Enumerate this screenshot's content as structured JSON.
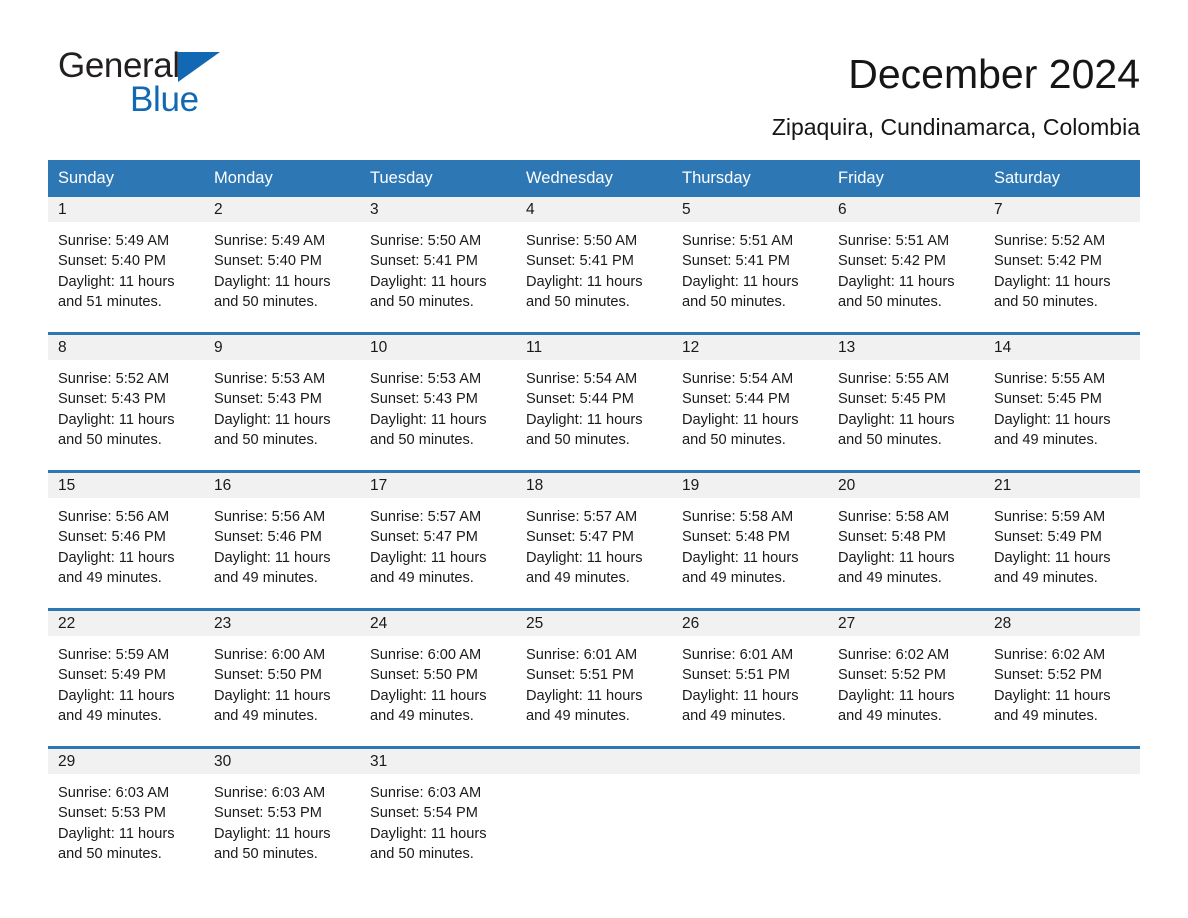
{
  "brand": {
    "name_part1": "General",
    "name_part2": "Blue",
    "accent_color": "#1268b3"
  },
  "header": {
    "title": "December 2024",
    "location": "Zipaquira, Cundinamarca, Colombia"
  },
  "calendar": {
    "header_color": "#2e77b5",
    "weekdays": [
      "Sunday",
      "Monday",
      "Tuesday",
      "Wednesday",
      "Thursday",
      "Friday",
      "Saturday"
    ],
    "weeks": [
      [
        {
          "day": "1",
          "sunrise": "Sunrise: 5:49 AM",
          "sunset": "Sunset: 5:40 PM",
          "daylight": "Daylight: 11 hours and 51 minutes."
        },
        {
          "day": "2",
          "sunrise": "Sunrise: 5:49 AM",
          "sunset": "Sunset: 5:40 PM",
          "daylight": "Daylight: 11 hours and 50 minutes."
        },
        {
          "day": "3",
          "sunrise": "Sunrise: 5:50 AM",
          "sunset": "Sunset: 5:41 PM",
          "daylight": "Daylight: 11 hours and 50 minutes."
        },
        {
          "day": "4",
          "sunrise": "Sunrise: 5:50 AM",
          "sunset": "Sunset: 5:41 PM",
          "daylight": "Daylight: 11 hours and 50 minutes."
        },
        {
          "day": "5",
          "sunrise": "Sunrise: 5:51 AM",
          "sunset": "Sunset: 5:41 PM",
          "daylight": "Daylight: 11 hours and 50 minutes."
        },
        {
          "day": "6",
          "sunrise": "Sunrise: 5:51 AM",
          "sunset": "Sunset: 5:42 PM",
          "daylight": "Daylight: 11 hours and 50 minutes."
        },
        {
          "day": "7",
          "sunrise": "Sunrise: 5:52 AM",
          "sunset": "Sunset: 5:42 PM",
          "daylight": "Daylight: 11 hours and 50 minutes."
        }
      ],
      [
        {
          "day": "8",
          "sunrise": "Sunrise: 5:52 AM",
          "sunset": "Sunset: 5:43 PM",
          "daylight": "Daylight: 11 hours and 50 minutes."
        },
        {
          "day": "9",
          "sunrise": "Sunrise: 5:53 AM",
          "sunset": "Sunset: 5:43 PM",
          "daylight": "Daylight: 11 hours and 50 minutes."
        },
        {
          "day": "10",
          "sunrise": "Sunrise: 5:53 AM",
          "sunset": "Sunset: 5:43 PM",
          "daylight": "Daylight: 11 hours and 50 minutes."
        },
        {
          "day": "11",
          "sunrise": "Sunrise: 5:54 AM",
          "sunset": "Sunset: 5:44 PM",
          "daylight": "Daylight: 11 hours and 50 minutes."
        },
        {
          "day": "12",
          "sunrise": "Sunrise: 5:54 AM",
          "sunset": "Sunset: 5:44 PM",
          "daylight": "Daylight: 11 hours and 50 minutes."
        },
        {
          "day": "13",
          "sunrise": "Sunrise: 5:55 AM",
          "sunset": "Sunset: 5:45 PM",
          "daylight": "Daylight: 11 hours and 50 minutes."
        },
        {
          "day": "14",
          "sunrise": "Sunrise: 5:55 AM",
          "sunset": "Sunset: 5:45 PM",
          "daylight": "Daylight: 11 hours and 49 minutes."
        }
      ],
      [
        {
          "day": "15",
          "sunrise": "Sunrise: 5:56 AM",
          "sunset": "Sunset: 5:46 PM",
          "daylight": "Daylight: 11 hours and 49 minutes."
        },
        {
          "day": "16",
          "sunrise": "Sunrise: 5:56 AM",
          "sunset": "Sunset: 5:46 PM",
          "daylight": "Daylight: 11 hours and 49 minutes."
        },
        {
          "day": "17",
          "sunrise": "Sunrise: 5:57 AM",
          "sunset": "Sunset: 5:47 PM",
          "daylight": "Daylight: 11 hours and 49 minutes."
        },
        {
          "day": "18",
          "sunrise": "Sunrise: 5:57 AM",
          "sunset": "Sunset: 5:47 PM",
          "daylight": "Daylight: 11 hours and 49 minutes."
        },
        {
          "day": "19",
          "sunrise": "Sunrise: 5:58 AM",
          "sunset": "Sunset: 5:48 PM",
          "daylight": "Daylight: 11 hours and 49 minutes."
        },
        {
          "day": "20",
          "sunrise": "Sunrise: 5:58 AM",
          "sunset": "Sunset: 5:48 PM",
          "daylight": "Daylight: 11 hours and 49 minutes."
        },
        {
          "day": "21",
          "sunrise": "Sunrise: 5:59 AM",
          "sunset": "Sunset: 5:49 PM",
          "daylight": "Daylight: 11 hours and 49 minutes."
        }
      ],
      [
        {
          "day": "22",
          "sunrise": "Sunrise: 5:59 AM",
          "sunset": "Sunset: 5:49 PM",
          "daylight": "Daylight: 11 hours and 49 minutes."
        },
        {
          "day": "23",
          "sunrise": "Sunrise: 6:00 AM",
          "sunset": "Sunset: 5:50 PM",
          "daylight": "Daylight: 11 hours and 49 minutes."
        },
        {
          "day": "24",
          "sunrise": "Sunrise: 6:00 AM",
          "sunset": "Sunset: 5:50 PM",
          "daylight": "Daylight: 11 hours and 49 minutes."
        },
        {
          "day": "25",
          "sunrise": "Sunrise: 6:01 AM",
          "sunset": "Sunset: 5:51 PM",
          "daylight": "Daylight: 11 hours and 49 minutes."
        },
        {
          "day": "26",
          "sunrise": "Sunrise: 6:01 AM",
          "sunset": "Sunset: 5:51 PM",
          "daylight": "Daylight: 11 hours and 49 minutes."
        },
        {
          "day": "27",
          "sunrise": "Sunrise: 6:02 AM",
          "sunset": "Sunset: 5:52 PM",
          "daylight": "Daylight: 11 hours and 49 minutes."
        },
        {
          "day": "28",
          "sunrise": "Sunrise: 6:02 AM",
          "sunset": "Sunset: 5:52 PM",
          "daylight": "Daylight: 11 hours and 49 minutes."
        }
      ],
      [
        {
          "day": "29",
          "sunrise": "Sunrise: 6:03 AM",
          "sunset": "Sunset: 5:53 PM",
          "daylight": "Daylight: 11 hours and 50 minutes."
        },
        {
          "day": "30",
          "sunrise": "Sunrise: 6:03 AM",
          "sunset": "Sunset: 5:53 PM",
          "daylight": "Daylight: 11 hours and 50 minutes."
        },
        {
          "day": "31",
          "sunrise": "Sunrise: 6:03 AM",
          "sunset": "Sunset: 5:54 PM",
          "daylight": "Daylight: 11 hours and 50 minutes."
        },
        {
          "day": "",
          "sunrise": "",
          "sunset": "",
          "daylight": ""
        },
        {
          "day": "",
          "sunrise": "",
          "sunset": "",
          "daylight": ""
        },
        {
          "day": "",
          "sunrise": "",
          "sunset": "",
          "daylight": ""
        },
        {
          "day": "",
          "sunrise": "",
          "sunset": "",
          "daylight": ""
        }
      ]
    ]
  }
}
